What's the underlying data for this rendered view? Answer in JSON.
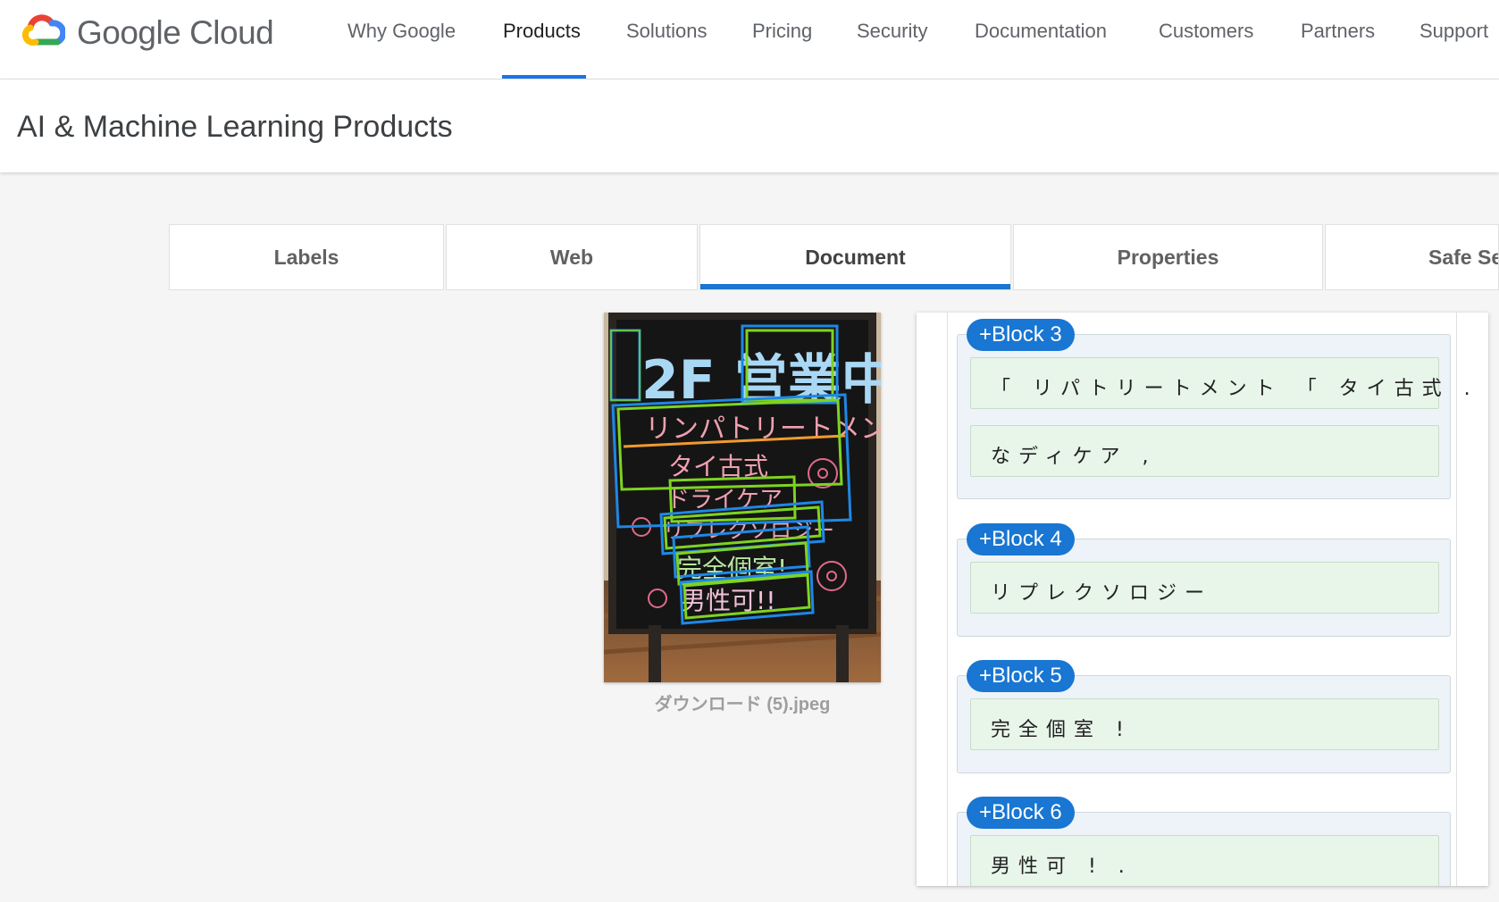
{
  "header": {
    "brand": "Google Cloud",
    "nav": [
      {
        "label": "Why Google"
      },
      {
        "label": "Products"
      },
      {
        "label": "Solutions"
      },
      {
        "label": "Pricing"
      },
      {
        "label": "Security"
      },
      {
        "label": "Documentation"
      },
      {
        "label": "Customers"
      },
      {
        "label": "Partners"
      },
      {
        "label": "Support"
      }
    ],
    "active_nav": "Products"
  },
  "page": {
    "title": "AI & Machine Learning Products"
  },
  "tabs": [
    {
      "label": "Labels"
    },
    {
      "label": "Web"
    },
    {
      "label": "Document"
    },
    {
      "label": "Properties"
    },
    {
      "label": "Safe Search"
    }
  ],
  "active_tab": "Document",
  "image": {
    "filename": "ダウンロード (5).jpeg",
    "sign_text": {
      "header": "2F 営業中",
      "line1": "リンパトリートメント",
      "line2": "タイ古式",
      "line3": "ドライケア",
      "line4": "リフレクソロジー",
      "line5": "完全個室!",
      "line6": "男性可!!"
    }
  },
  "blocks": [
    {
      "label": "+Block 3",
      "lines": [
        "「 リパトリートメント 「 タイ古式 . 。",
        "なディケア ,"
      ]
    },
    {
      "label": "+Block 4",
      "lines": [
        "リプレクソロジー"
      ]
    },
    {
      "label": "+Block 5",
      "lines": [
        "完全個室 !"
      ]
    },
    {
      "label": "+Block 6",
      "lines": [
        "男性可 ! ."
      ]
    }
  ],
  "colors": {
    "accent": "#1976d2",
    "nav_underline": "#1a73e8",
    "block_bg": "#edf3f8",
    "line_bg": "#e8f5e9"
  }
}
